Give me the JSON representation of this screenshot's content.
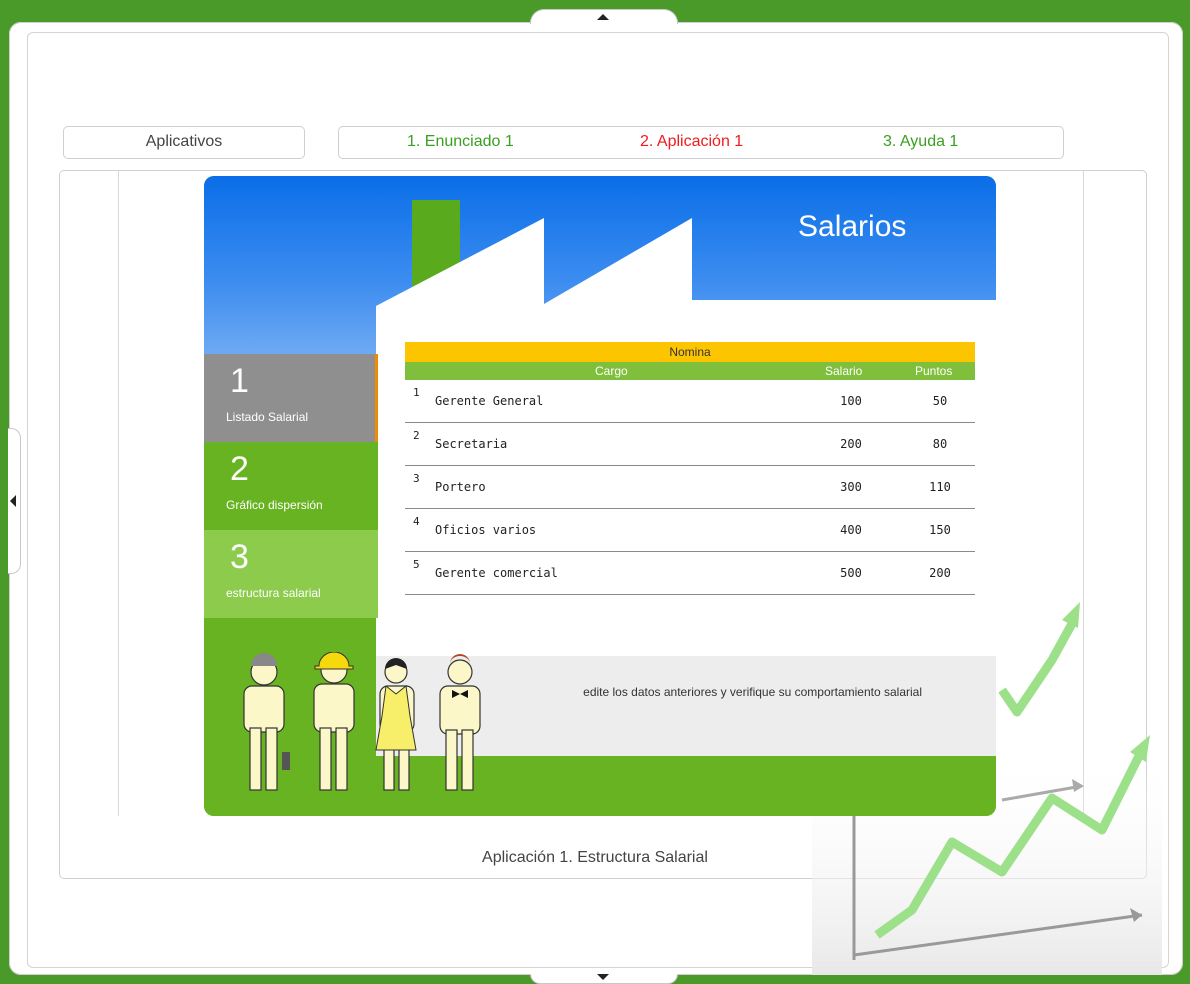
{
  "nav": {
    "apps_label": "Aplicativos",
    "steps": [
      {
        "label": "1. Enunciado 1",
        "color": "#3aa020"
      },
      {
        "label": "2. Aplicación 1",
        "color": "#ee1c1c"
      },
      {
        "label": "3. Ayuda 1",
        "color": "#3aa020"
      }
    ]
  },
  "app": {
    "title": "Salarios",
    "menu": [
      {
        "num": "1",
        "label": "Listado Salarial"
      },
      {
        "num": "2",
        "label": "Gráfico dispersión"
      },
      {
        "num": "3",
        "label": "estructura salarial"
      }
    ],
    "table": {
      "caption": "Nomina",
      "headers": {
        "cargo": "Cargo",
        "salario": "Salario",
        "puntos": "Puntos"
      },
      "rows": [
        {
          "idx": "1",
          "cargo": "Gerente General",
          "salario": "100",
          "puntos": "50"
        },
        {
          "idx": "2",
          "cargo": "Secretaria",
          "salario": "200",
          "puntos": "80"
        },
        {
          "idx": "3",
          "cargo": "Portero",
          "salario": "300",
          "puntos": "110"
        },
        {
          "idx": "4",
          "cargo": "Oficios varios",
          "salario": "400",
          "puntos": "150"
        },
        {
          "idx": "5",
          "cargo": "Gerente comercial",
          "salario": "500",
          "puntos": "200"
        }
      ]
    },
    "notice": "edite los datos anteriores y verifique su comportamiento salarial"
  },
  "caption": "Aplicación 1. Estructura Salarial",
  "colors": {
    "frame_green": "#4a9a2a",
    "app_green": "#67b321",
    "header_yellow": "#fdc500",
    "accent_orange": "#f08c00"
  },
  "icons": [
    "chevron-up-icon",
    "chevron-down-icon",
    "chevron-left-icon"
  ]
}
